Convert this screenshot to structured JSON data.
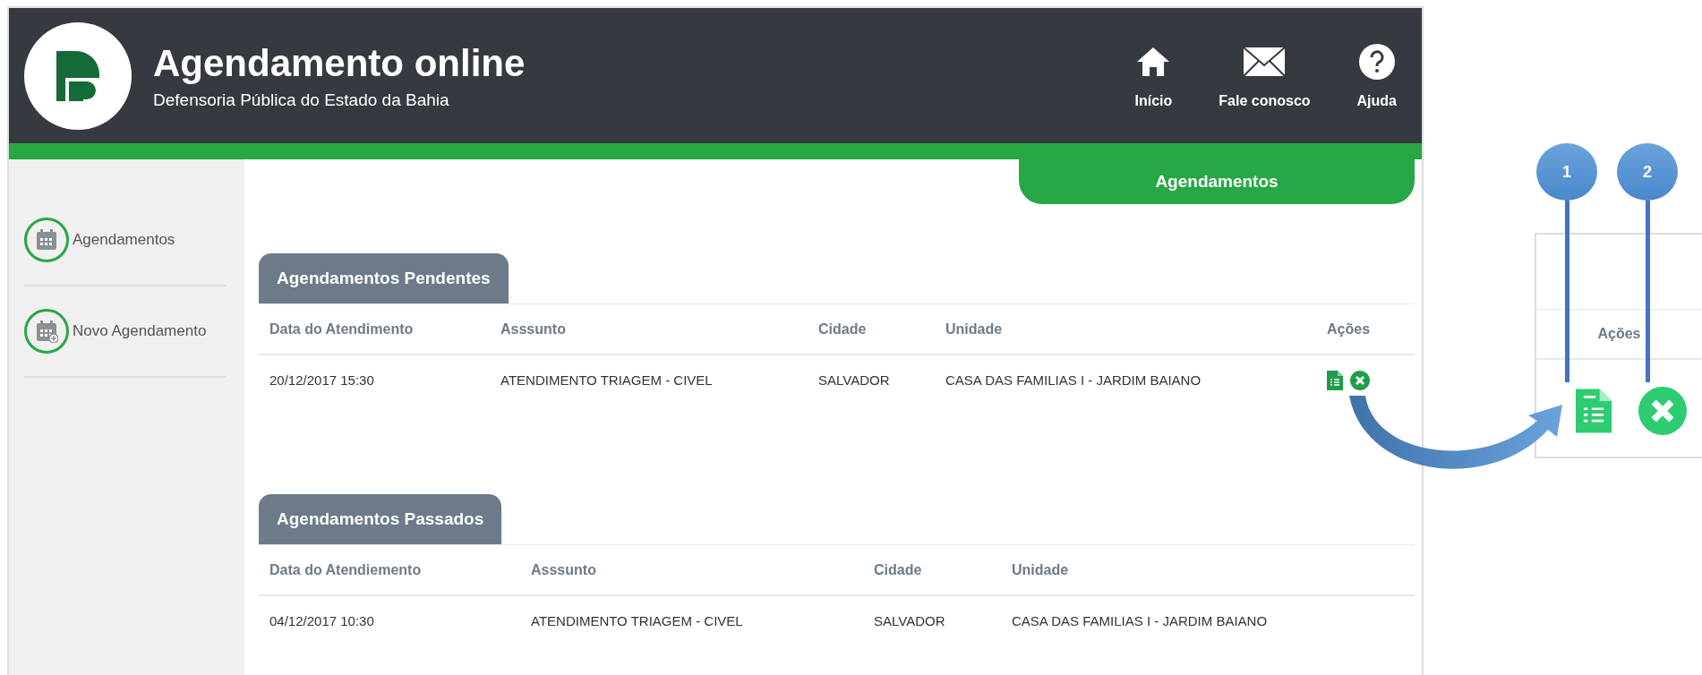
{
  "header": {
    "title": "Agendamento online",
    "subtitle": "Defensoria Pública do Estado da Bahia",
    "nav": [
      {
        "label": "Início",
        "kind": "home"
      },
      {
        "label": "Fale conosco",
        "kind": "mail"
      },
      {
        "label": "Ajuda",
        "kind": "help"
      }
    ]
  },
  "sidebar": {
    "items": [
      {
        "label": "Agendamentos",
        "kind": "calendar"
      },
      {
        "label": "Novo Agendamento",
        "kind": "calendar-add"
      }
    ]
  },
  "page_tab": "Agendamentos",
  "sections": [
    {
      "title": "Agendamentos Pendentes",
      "columns": [
        "Data do Atendimento",
        "Asssunto",
        "Cidade",
        "Unidade",
        "Ações"
      ],
      "rows": [
        {
          "cells": [
            "20/12/2017 15:30",
            "ATENDIMENTO TRIAGEM - CIVEL",
            "SALVADOR",
            "CASA DAS FAMILIAS I - JARDIM BAIANO"
          ],
          "actions": [
            {
              "kind": "details"
            },
            {
              "kind": "cancel"
            }
          ]
        }
      ]
    },
    {
      "title": "Agendamentos Passados",
      "columns": [
        "Data do Atendiemento",
        "Asssunto",
        "Cidade",
        "Unidade"
      ],
      "rows": [
        {
          "cells": [
            "04/12/2017 10:30",
            "ATENDIMENTO TRIAGEM - CIVEL",
            "SALVADOR",
            "CASA DAS FAMILIAS I - JARDIM BAIANO"
          ]
        }
      ]
    }
  ],
  "callout": {
    "column": "Ações",
    "markers": [
      {
        "number": "1",
        "kind": "details"
      },
      {
        "number": "2",
        "kind": "cancel"
      }
    ]
  }
}
